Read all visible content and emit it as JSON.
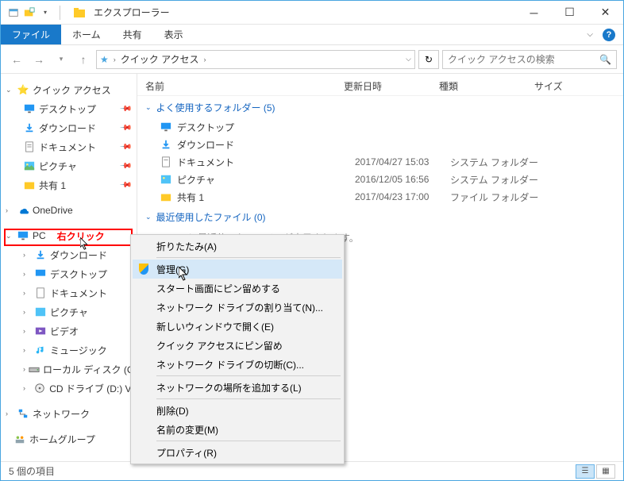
{
  "window": {
    "title": "エクスプローラー"
  },
  "ribbon": {
    "file": "ファイル",
    "tabs": [
      "ホーム",
      "共有",
      "表示"
    ]
  },
  "breadcrumb": {
    "label": "クイック アクセス",
    "search_placeholder": "クイック アクセスの検索"
  },
  "columns": {
    "name": "名前",
    "date": "更新日時",
    "type": "種類",
    "size": "サイズ"
  },
  "sidebar": {
    "quick_access": "クイック アクセス",
    "desktop": "デスクトップ",
    "downloads": "ダウンロード",
    "documents": "ドキュメント",
    "pictures": "ピクチャ",
    "share1": "共有 1",
    "onedrive": "OneDrive",
    "pc": "PC",
    "s_downloads": "ダウンロード",
    "s_desktop": "デスクトップ",
    "s_documents": "ドキュメント",
    "s_pictures": "ピクチャ",
    "s_videos": "ビデオ",
    "s_music": "ミュージック",
    "s_localdisk": "ローカル ディスク (C:)",
    "s_cddrive": "CD ドライブ (D:) Vir",
    "network": "ネットワーク",
    "homegroup": "ホームグループ"
  },
  "annotation": {
    "right_click": "右クリック"
  },
  "groups": {
    "frequent": {
      "label": "よく使用するフォルダー (5)"
    },
    "recent": {
      "label": "最近使用したファイル (0)",
      "empty": "、ここに最近使ったファイルが表示されます。"
    }
  },
  "files": [
    {
      "name": "デスクトップ",
      "date": "",
      "type": "",
      "icon": "monitor"
    },
    {
      "name": "ダウンロード",
      "date": "",
      "type": "",
      "icon": "download"
    },
    {
      "name": "ドキュメント",
      "date": "2017/04/27 15:03",
      "type": "システム フォルダー",
      "icon": "doc"
    },
    {
      "name": "ピクチャ",
      "date": "2016/12/05 16:56",
      "type": "システム フォルダー",
      "icon": "pic"
    },
    {
      "name": "共有 1",
      "date": "2017/04/23 17:00",
      "type": "ファイル フォルダー",
      "icon": "folder"
    }
  ],
  "context_menu": {
    "collapse": "折りたたみ(A)",
    "manage": "管理(G)",
    "pin_start": "スタート画面にピン留めする",
    "map_drive": "ネットワーク ドライブの割り当て(N)...",
    "new_window": "新しいウィンドウで開く(E)",
    "pin_qa": "クイック アクセスにピン留め",
    "disconnect": "ネットワーク ドライブの切断(C)...",
    "add_location": "ネットワークの場所を追加する(L)",
    "delete": "削除(D)",
    "rename": "名前の変更(M)",
    "properties": "プロパティ(R)"
  },
  "statusbar": {
    "count": "5 個の項目"
  }
}
